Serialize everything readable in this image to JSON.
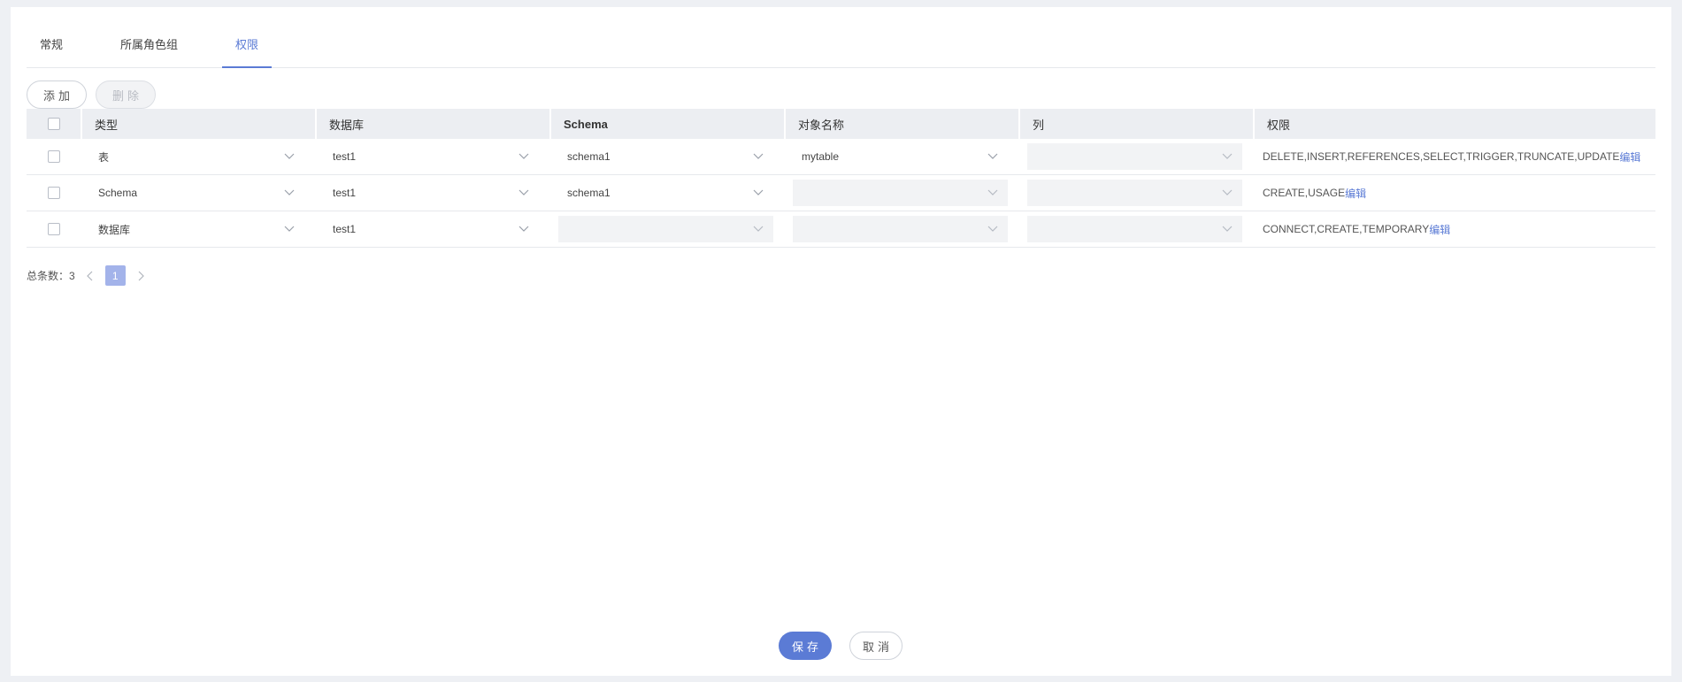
{
  "tabs": [
    {
      "label": "常规",
      "active": false
    },
    {
      "label": "所属角色组",
      "active": false
    },
    {
      "label": "权限",
      "active": true
    }
  ],
  "toolbar": {
    "add_label": "添加",
    "delete_label": "删除"
  },
  "table": {
    "headers": {
      "type": "类型",
      "database": "数据库",
      "schema": "Schema",
      "object_name": "对象名称",
      "column": "列",
      "permission": "权限"
    },
    "rows": [
      {
        "type": "表",
        "database": "test1",
        "schema": "schema1",
        "object_name": "mytable",
        "column": "",
        "permission": "DELETE,INSERT,REFERENCES,SELECT,TRIGGER,TRUNCATE,UPDATE",
        "edit": "编辑"
      },
      {
        "type": "Schema",
        "database": "test1",
        "schema": "schema1",
        "object_name": "",
        "column": "",
        "permission": "CREATE,USAGE",
        "edit": "编辑"
      },
      {
        "type": "数据库",
        "database": "test1",
        "schema": "",
        "object_name": "",
        "column": "",
        "permission": "CONNECT,CREATE,TEMPORARY",
        "edit": "编辑"
      }
    ]
  },
  "pagination": {
    "total_label": "总条数：",
    "total": "3",
    "current_page": "1"
  },
  "footer": {
    "save_label": "保存",
    "cancel_label": "取消"
  },
  "colors": {
    "accent": "#5b7bd5",
    "page_active": "#a3b3ea",
    "header_bg": "#eceef2"
  }
}
